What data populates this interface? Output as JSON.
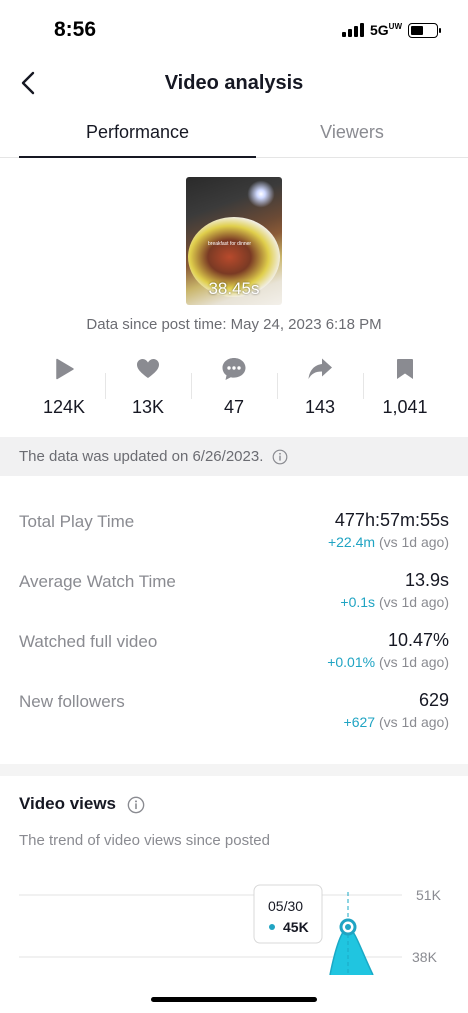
{
  "status_bar": {
    "time": "8:56",
    "network": "5G",
    "network_suffix": "UW"
  },
  "nav": {
    "title": "Video analysis",
    "back_icon": "chevron-left-icon"
  },
  "tabs": [
    {
      "label": "Performance",
      "active": true
    },
    {
      "label": "Viewers",
      "active": false
    }
  ],
  "video": {
    "caption": "breakfast for dinner",
    "duration": "38.45s",
    "data_since": "Data since post time: May 24, 2023 6:18 PM"
  },
  "stats": [
    {
      "icon": "play-icon",
      "value": "124K"
    },
    {
      "icon": "heart-icon",
      "value": "13K"
    },
    {
      "icon": "comment-icon",
      "value": "47"
    },
    {
      "icon": "share-icon",
      "value": "143"
    },
    {
      "icon": "bookmark-icon",
      "value": "1,041"
    }
  ],
  "notice": {
    "text": "The data was updated on 6/26/2023."
  },
  "metrics": [
    {
      "label": "Total Play Time",
      "value": "477h:57m:55s",
      "delta": "+22.4m",
      "delta_suffix": " (vs 1d ago)"
    },
    {
      "label": "Average Watch Time",
      "value": "13.9s",
      "delta": "+0.1s",
      "delta_suffix": " (vs 1d ago)"
    },
    {
      "label": "Watched full video",
      "value": "10.47%",
      "delta": "+0.01%",
      "delta_suffix": " (vs 1d ago)"
    },
    {
      "label": "New followers",
      "value": "629",
      "delta": "+627",
      "delta_suffix": " (vs 1d ago)"
    }
  ],
  "video_views": {
    "title": "Video views",
    "subtitle": "The trend of video views since posted"
  },
  "chart_data": {
    "type": "area",
    "y_ticks": [
      "51K",
      "38K"
    ],
    "tooltip": {
      "date": "05/30",
      "value": "45K"
    },
    "color": "#20c5e0"
  },
  "colors": {
    "accent": "#20a4c3",
    "text": "#161823",
    "muted": "#8a8b91"
  }
}
